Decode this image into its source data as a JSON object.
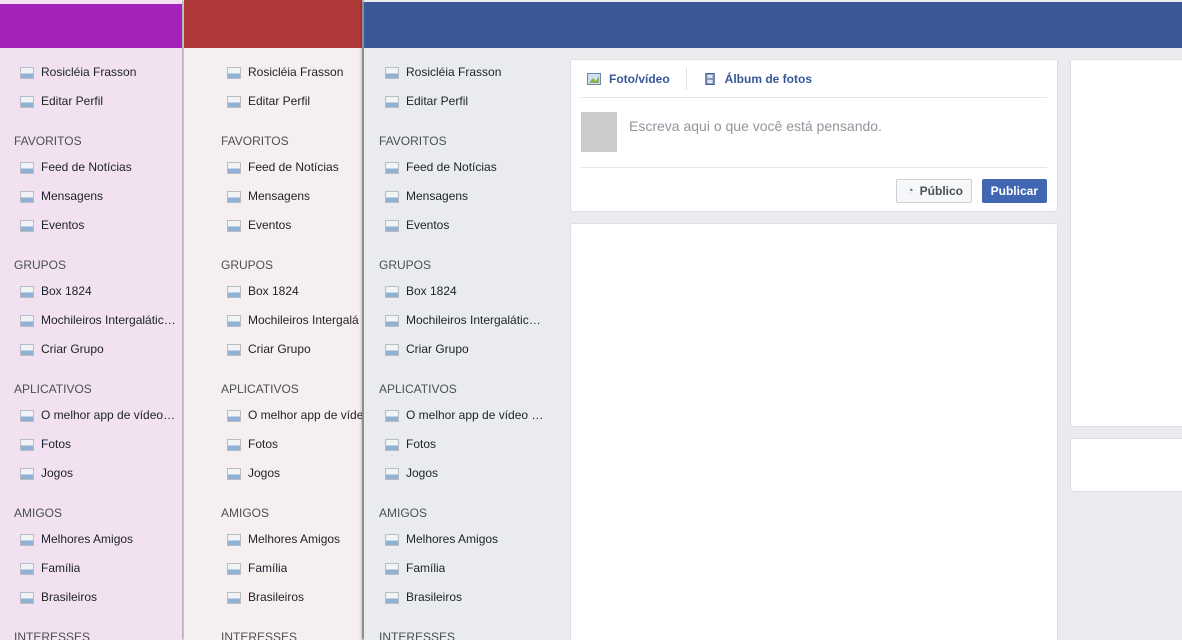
{
  "colors": {
    "purple_bar": "#a620ba",
    "red_bar": "#b03a3a",
    "facebook_bar": "#3b5998",
    "publish_button": "#4267b2"
  },
  "windows": [
    {
      "nav": {
        "profile_name": "Rosicléia Frasson",
        "edit_profile": "Editar Perfil",
        "favorites_heading": "FAVORITOS",
        "favorites": [
          "Feed de Notícias",
          "Mensagens",
          "Eventos"
        ],
        "groups_heading": "GRUPOS",
        "groups": [
          "Box 1824",
          "Mochileiros Intergalátic…",
          "Criar Grupo"
        ],
        "apps_heading": "APLICATIVOS",
        "apps": [
          "O melhor app de vídeo …",
          "Fotos",
          "Jogos"
        ],
        "friends_heading": "AMIGOS",
        "friends": [
          "Melhores Amigos",
          "Família",
          "Brasileiros"
        ],
        "interests_heading": "INTERESSES"
      }
    },
    {
      "nav": {
        "profile_name": "Rosicléia Frasson",
        "edit_profile": "Editar Perfil",
        "favorites_heading": "FAVORITOS",
        "favorites": [
          "Feed de Notícias",
          "Mensagens",
          "Eventos"
        ],
        "groups_heading": "GRUPOS",
        "groups": [
          "Box 1824",
          "Mochileiros Intergalá",
          "Criar Grupo"
        ],
        "apps_heading": "APLICATIVOS",
        "apps": [
          "O melhor app de víde",
          "Fotos",
          "Jogos"
        ],
        "friends_heading": "AMIGOS",
        "friends": [
          "Melhores Amigos",
          "Família",
          "Brasileiros"
        ],
        "interests_heading": "INTERESSES"
      }
    },
    {
      "nav": {
        "profile_name": "Rosicléia Frasson",
        "edit_profile": "Editar Perfil",
        "favorites_heading": "FAVORITOS",
        "favorites": [
          "Feed de Notícias",
          "Mensagens",
          "Eventos"
        ],
        "groups_heading": "GRUPOS",
        "groups": [
          "Box 1824",
          "Mochileiros Intergalátic…",
          "Criar Grupo"
        ],
        "apps_heading": "APLICATIVOS",
        "apps": [
          "O melhor app de vídeo …",
          "Fotos",
          "Jogos"
        ],
        "friends_heading": "AMIGOS",
        "friends": [
          "Melhores Amigos",
          "Família",
          "Brasileiros"
        ],
        "interests_heading": "INTERESSES"
      },
      "composer": {
        "tab_photo_video": "Foto/vídeo",
        "tab_photo_album": "Álbum de fotos",
        "placeholder": "Escreva aqui o que você está pensando.",
        "privacy_label": "Público",
        "publish_label": "Publicar"
      }
    }
  ]
}
